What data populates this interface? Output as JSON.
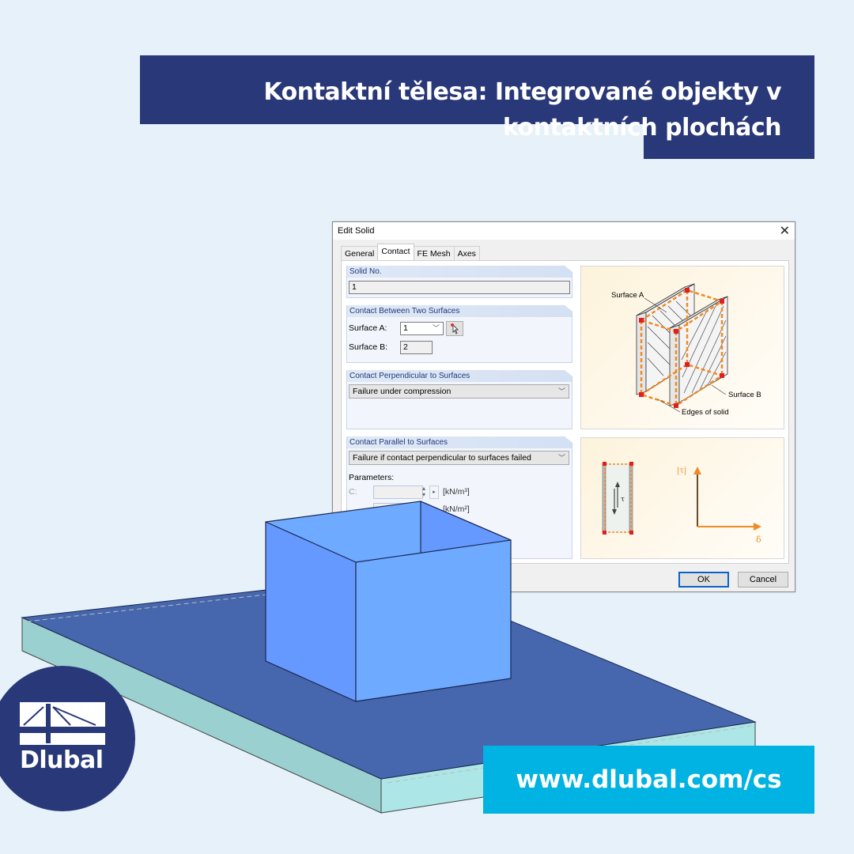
{
  "header": {
    "title": "Kontaktní tělesa: Integrované objekty v kontaktních plochách"
  },
  "dialog": {
    "title": "Edit Solid",
    "close_icon": "close-icon",
    "tabs": [
      {
        "label": "General",
        "active": false
      },
      {
        "label": "Contact",
        "active": true
      },
      {
        "label": "FE Mesh",
        "active": false
      },
      {
        "label": "Axes",
        "active": false
      }
    ],
    "solid_no": {
      "group_label": "Solid No.",
      "value": "1"
    },
    "contact_between": {
      "group_label": "Contact Between Two Surfaces",
      "surface_a_label": "Surface A:",
      "surface_a_value": "1",
      "surface_b_label": "Surface B:",
      "surface_b_value": "2",
      "pick_icon": "pick-surface-icon"
    },
    "contact_perpendicular": {
      "group_label": "Contact Perpendicular to Surfaces",
      "selected": "Failure under compression"
    },
    "contact_parallel": {
      "group_label": "Contact Parallel to Surfaces",
      "selected": "Failure if contact perpendicular to surfaces failed",
      "parameters_label": "Parameters:",
      "c_label": "C:",
      "c_value": "",
      "c_unit": "[kN/m³]",
      "second_unit": "[kN/m²]"
    },
    "figure_top": {
      "surface_a_label": "Surface A",
      "surface_b_label": "Surface B",
      "edges_label": "Edges of solid"
    },
    "figure_bottom": {
      "tau_label": "τ",
      "y_axis_label": "|τ|",
      "x_axis_label": "δ"
    },
    "ok_label": "OK",
    "cancel_label": "Cancel"
  },
  "model": {
    "slab_top_color": "#4666ad",
    "slab_side_color": "#9ad0d0",
    "slab_front_color": "#ade6e6",
    "box_left_color": "#6699ff",
    "box_right_color": "#6eaaff"
  },
  "brand": {
    "logo_text": "Dlubal",
    "url": "www.dlubal.com/cs",
    "primary_color": "#283878",
    "accent_color": "#00b3e3"
  }
}
